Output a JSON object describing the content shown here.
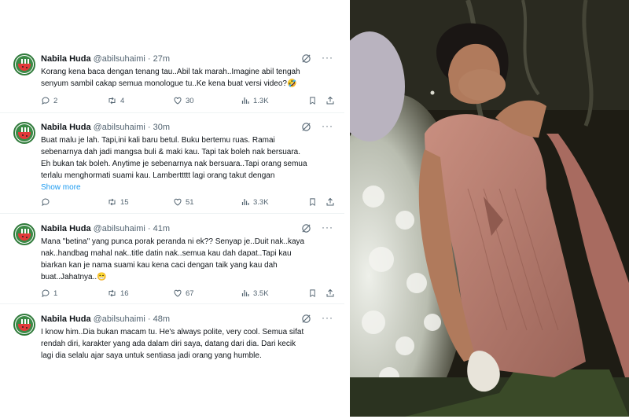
{
  "tweets": [
    {
      "name": "Nabila Huda",
      "handle": "@abilsuhaimi",
      "time": "· 27m",
      "lines": [
        "Korang kena baca dengan tenang tau..Abil tak marah..Imagine abil tengah",
        "senyum sambil cakap semua monologue tu..Ke kena buat versi video?🤣"
      ],
      "show_more": "",
      "replies": "2",
      "retweets": "4",
      "likes": "30",
      "views": "1.3K"
    },
    {
      "name": "Nabila Huda",
      "handle": "@abilsuhaimi",
      "time": "· 30m",
      "lines": [
        "Buat malu je lah. Tapi,ini kali baru betul. Buku bertemu ruas. Ramai",
        "sebenarnya dah jadi mangsa buli & maki kau. Tapi tak boleh nak bersuara.",
        "Eh bukan tak boleh. Anytime je sebenarnya nak bersuara..Tapi orang semua",
        "terlalu menghormati suami kau. Lamberttttt lagi orang takut dengan"
      ],
      "show_more": "Show more",
      "replies": "",
      "retweets": "15",
      "likes": "51",
      "views": "3.3K"
    },
    {
      "name": "Nabila Huda",
      "handle": "@abilsuhaimi",
      "time": "· 41m",
      "lines": [
        "Mana \"betina\" yang punca porak peranda ni ek?? Senyap je..Duit nak..kaya",
        "nak..handbag mahal nak..title datin nak..semua kau dah dapat..Tapi kau",
        "biarkan kan je nama suami kau kena caci dengan taik yang kau dah",
        "buat..Jahatnya..😁"
      ],
      "show_more": "",
      "replies": "1",
      "retweets": "16",
      "likes": "67",
      "views": "3.5K"
    },
    {
      "name": "Nabila Huda",
      "handle": "@abilsuhaimi",
      "time": "· 48m",
      "lines": [
        "I know him..Dia bukan macam tu. He's always polite, very cool. Semua sifat",
        "rendah diri, karakter yang ada dalam diri saya, datang dari dia. Dari kecik",
        "lagi dia selalu ajar saya untuk sentiasa jadi orang yang humble."
      ],
      "show_more": "",
      "replies": "",
      "retweets": "",
      "likes": "",
      "views": ""
    }
  ],
  "icons": {
    "reply": "reply-icon",
    "retweet": "retweet-icon",
    "like": "heart-icon",
    "views": "views-icon",
    "bookmark": "bookmark-icon",
    "share": "share-icon",
    "grok": "grok-icon",
    "more": "more-icon"
  },
  "colors": {
    "link": "#1d9bf0",
    "muted": "#536471",
    "text": "#0f1419",
    "dress": "#b87a6c"
  }
}
